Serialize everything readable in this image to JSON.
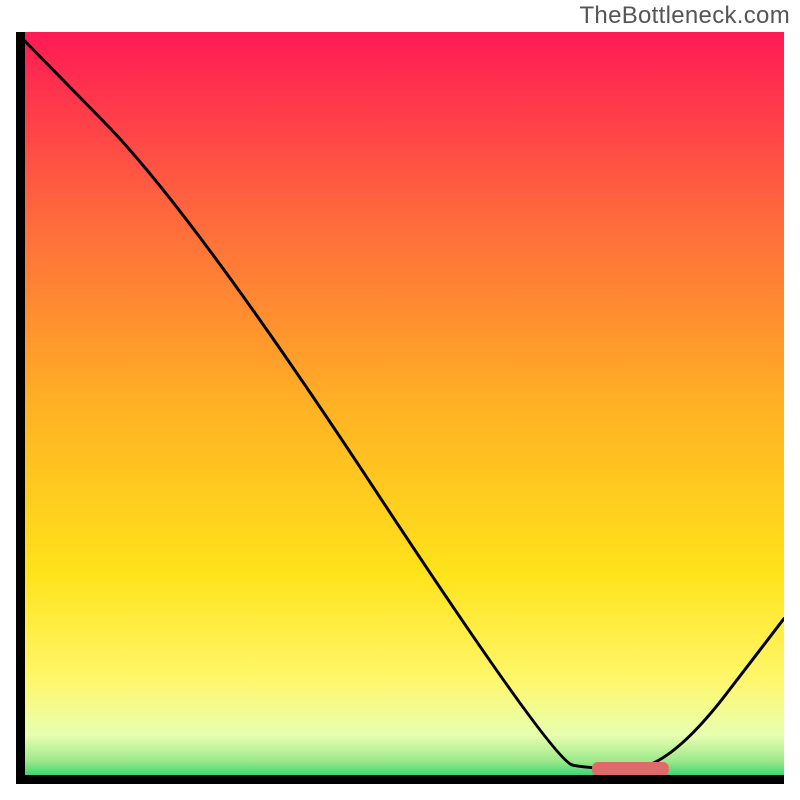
{
  "watermark": "TheBottleneck.com",
  "chart_data": {
    "type": "line",
    "title": "",
    "xlabel": "",
    "ylabel": "",
    "xlim": [
      0,
      100
    ],
    "ylim": [
      0,
      100
    ],
    "series": [
      {
        "name": "curve",
        "x": [
          0,
          23,
          70,
          75,
          85,
          100
        ],
        "values": [
          100,
          76,
          3,
          2,
          2,
          22
        ]
      }
    ],
    "marker": {
      "x_start": 75,
      "x_end": 85,
      "y": 2
    },
    "gradient_stops": [
      {
        "offset": 0.0,
        "color": "#ff1a55"
      },
      {
        "offset": 0.25,
        "color": "#ff6a3c"
      },
      {
        "offset": 0.5,
        "color": "#ffb224"
      },
      {
        "offset": 0.72,
        "color": "#ffe31a"
      },
      {
        "offset": 0.86,
        "color": "#fff76a"
      },
      {
        "offset": 0.935,
        "color": "#e8ffb0"
      },
      {
        "offset": 0.97,
        "color": "#9be88a"
      },
      {
        "offset": 1.0,
        "color": "#00c864"
      }
    ]
  }
}
